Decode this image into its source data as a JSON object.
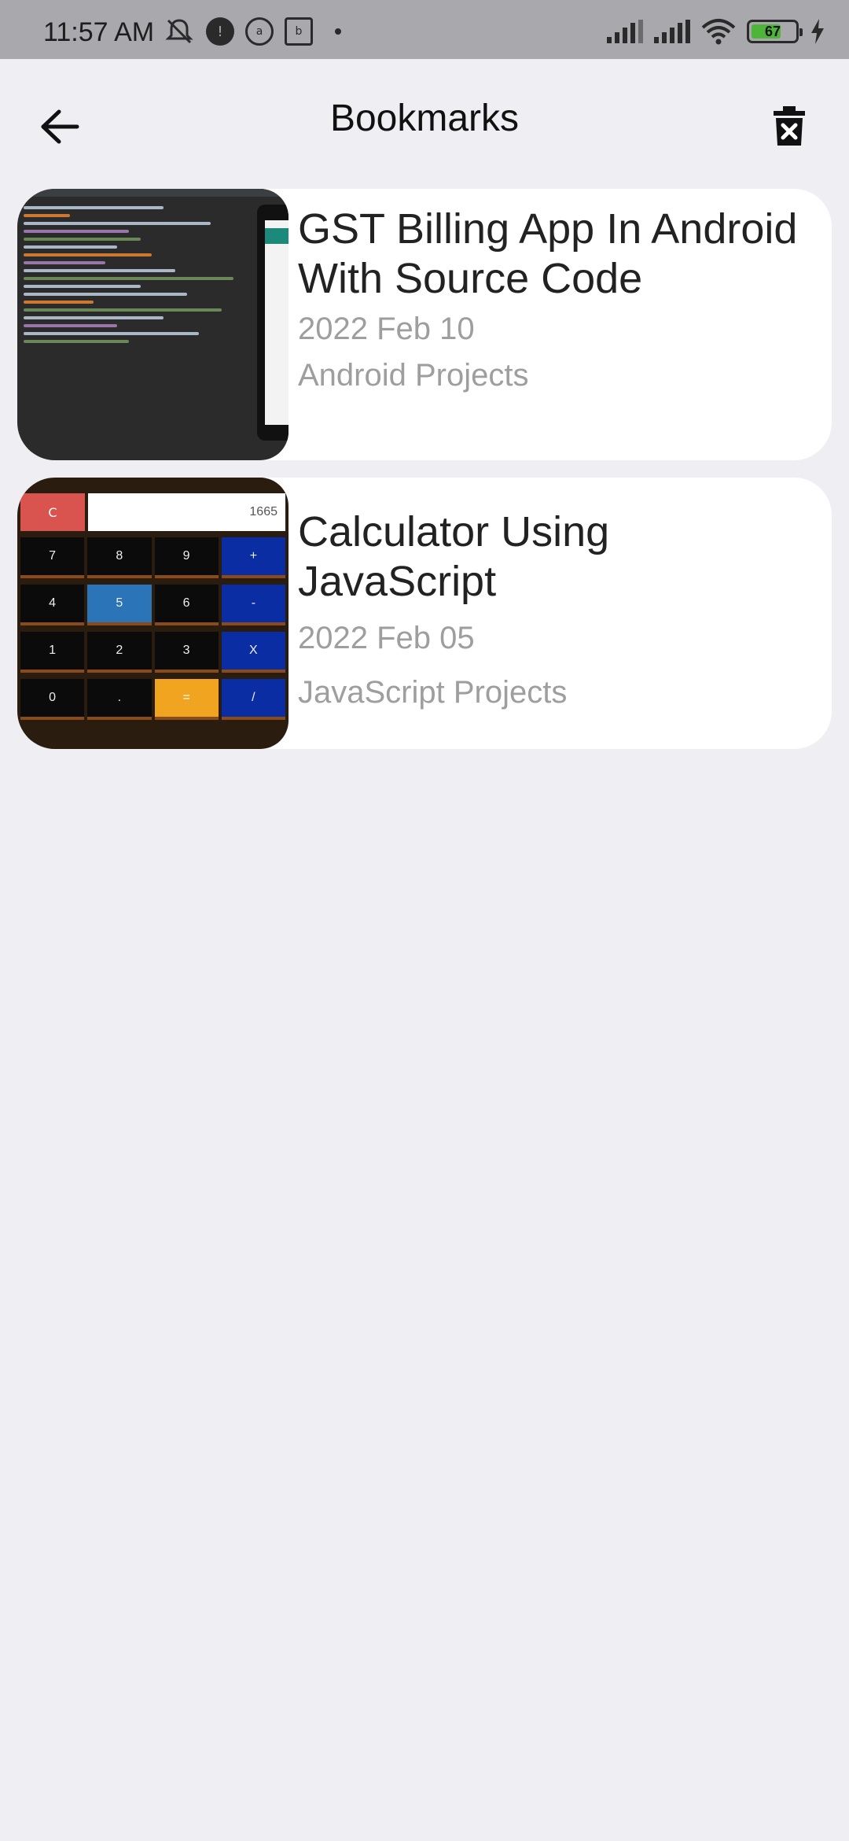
{
  "status_bar": {
    "time": "11:57 AM",
    "battery": "67",
    "icons": [
      "mute-icon",
      "notification-icon",
      "app-icon-1",
      "app-icon-2",
      "signal-icon",
      "wifi-icon",
      "battery-icon",
      "charging-icon"
    ]
  },
  "header": {
    "title": "Bookmarks",
    "back_icon": "back-arrow-icon",
    "delete_icon": "delete-all-icon"
  },
  "bookmarks": [
    {
      "title": "GST Billing App In Android With Source Code",
      "date": "2022 Feb 10",
      "category": "Android Projects",
      "thumbnail": "code-editor-thumbnail"
    },
    {
      "title": "Calculator Using JavaScript",
      "date": "2022 Feb 05",
      "category": "JavaScript Projects",
      "thumbnail": "calculator-thumbnail",
      "calc_display": "1665",
      "calc_keys": [
        [
          "C"
        ],
        [
          "7",
          "8",
          "9",
          "+"
        ],
        [
          "4",
          "5",
          "6",
          "-"
        ],
        [
          "1",
          "2",
          "3",
          "X"
        ],
        [
          "0",
          ".",
          "=",
          "/"
        ]
      ]
    }
  ],
  "colors": {
    "background": "#efeef2",
    "card": "#ffffff",
    "muted_text": "#9e9e9e",
    "status_bar": "#a9a8ad"
  }
}
